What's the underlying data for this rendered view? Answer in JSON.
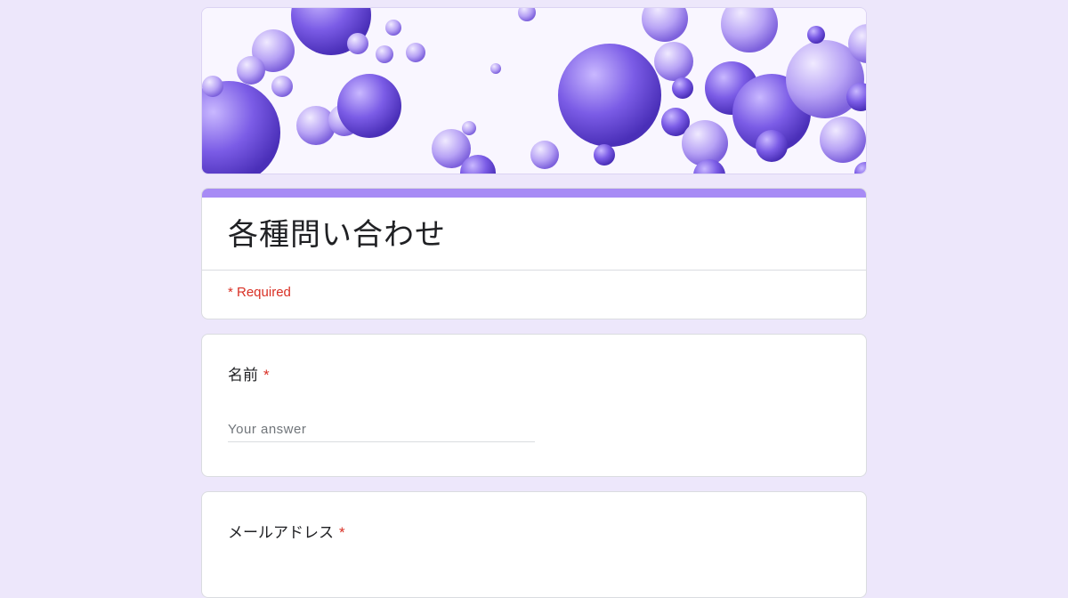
{
  "form": {
    "title": "各種問い合わせ",
    "required_note": "* Required",
    "accent_color": "#a78bf5",
    "background_color": "#ede7fb",
    "required_color": "#d93025"
  },
  "header_image": {
    "description": "purple-bubbles-banner"
  },
  "questions": [
    {
      "label": "名前",
      "required_mark": "*",
      "placeholder": "Your answer"
    },
    {
      "label": "メールアドレス",
      "required_mark": "*"
    }
  ]
}
